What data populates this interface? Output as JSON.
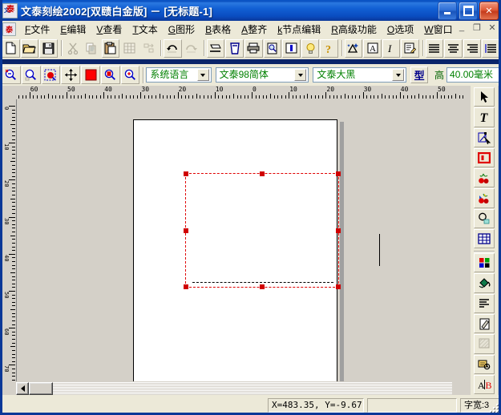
{
  "window": {
    "title": "文泰刻绘2002[双赜白金版]  －  [无标题-1]",
    "app_icon": "app-icon",
    "minimize": "_",
    "maximize": "□",
    "close": "✕"
  },
  "menubar": {
    "items": [
      {
        "accel": "F",
        "label": "文件",
        "name": "menu-file"
      },
      {
        "accel": "E",
        "label": "编辑",
        "name": "menu-edit"
      },
      {
        "accel": "V",
        "label": "查看",
        "name": "menu-view"
      },
      {
        "accel": "T",
        "label": "文本",
        "name": "menu-text"
      },
      {
        "accel": "G",
        "label": "图形",
        "name": "menu-graphics"
      },
      {
        "accel": "B",
        "label": "表格",
        "name": "menu-table"
      },
      {
        "accel": "A",
        "label": "整齐",
        "name": "menu-align"
      },
      {
        "accel": "k",
        "label": "节点编辑",
        "name": "menu-node-edit"
      },
      {
        "accel": "R",
        "label": "高级功能",
        "name": "menu-advanced"
      },
      {
        "accel": "O",
        "label": "选项",
        "name": "menu-options"
      },
      {
        "accel": "W",
        "label": "窗口",
        "name": "menu-window"
      }
    ],
    "mdi_minimize": "_",
    "mdi_restore": "❐",
    "mdi_close": "✕"
  },
  "toolbar_main": {
    "buttons": [
      {
        "name": "new-file-icon",
        "tip": "新建"
      },
      {
        "name": "open-file-icon",
        "tip": "打开"
      },
      {
        "name": "save-file-icon",
        "tip": "保存"
      },
      {
        "name": "cut-icon",
        "tip": "剪切"
      },
      {
        "name": "copy-icon",
        "tip": "复制"
      },
      {
        "name": "paste-icon",
        "tip": "粘贴"
      },
      {
        "name": "array-copy-icon",
        "tip": "阵列"
      },
      {
        "name": "transform-icon",
        "tip": "变换"
      },
      {
        "name": "undo-icon",
        "tip": "撤销"
      },
      {
        "name": "redo-icon",
        "tip": "重做"
      },
      {
        "name": "cut-plot-icon",
        "tip": "刻绘输出"
      },
      {
        "name": "engrave-icon",
        "tip": "雕刻"
      },
      {
        "name": "print-icon",
        "tip": "打印"
      },
      {
        "name": "print-preview-icon",
        "tip": "打印预览"
      },
      {
        "name": "layout-icon",
        "tip": "排版"
      },
      {
        "name": "hint-icon",
        "tip": "提示"
      },
      {
        "name": "help-icon",
        "tip": "帮助"
      },
      {
        "name": "effect-icon",
        "tip": "特效"
      },
      {
        "name": "text-box-icon",
        "tip": "文字框"
      },
      {
        "name": "italic-icon",
        "tip": "倾斜"
      },
      {
        "name": "edit-note-icon",
        "tip": "编辑文本"
      },
      {
        "name": "align-left-icon",
        "tip": "左对齐"
      },
      {
        "name": "align-center-icon",
        "tip": "居中"
      },
      {
        "name": "align-right-icon",
        "tip": "右对齐"
      },
      {
        "name": "align-justify-icon",
        "tip": "分散对齐"
      }
    ]
  },
  "toolbar_view": {
    "buttons": [
      {
        "name": "zoom-out-icon",
        "tip": "缩小"
      },
      {
        "name": "zoom-area-icon",
        "tip": "框选缩放"
      },
      {
        "name": "zoom-selection-icon",
        "tip": "选中对象满屏"
      },
      {
        "name": "pan-icon",
        "tip": "平移"
      },
      {
        "name": "color-swatch-icon",
        "tip": "颜色",
        "color": "#ff0000"
      },
      {
        "name": "zoom-page-icon",
        "tip": "整页显示"
      },
      {
        "name": "zoom-fit-icon",
        "tip": "满屏显示"
      }
    ],
    "language_combo": {
      "value": "系统语言",
      "name": "language-combo"
    },
    "font_combo": {
      "value": "文泰98简体",
      "name": "font-combo"
    },
    "style_combo": {
      "value": "文泰大黑",
      "name": "style-combo"
    },
    "type_button": {
      "label": "型",
      "name": "type-button"
    },
    "height_label": "高",
    "height_value": "40.00毫米"
  },
  "rulers": {
    "unit": "毫米",
    "horizontal_ticks": [
      "20",
      "10",
      "0",
      "10",
      "20"
    ],
    "vertical_ticks": [
      "0",
      "10",
      "20",
      "30",
      "40",
      "50",
      "60",
      "70"
    ]
  },
  "canvas": {
    "page_name": "document-page",
    "selection": {
      "name": "selection-rectangle",
      "handles": 8,
      "color": "#e00000"
    },
    "caret_name": "text-caret"
  },
  "right_toolbar": {
    "buttons": [
      {
        "name": "select-arrow-icon",
        "tip": "选择"
      },
      {
        "name": "text-tool-icon",
        "tip": "文字"
      },
      {
        "name": "node-edit-icon",
        "tip": "节点编辑"
      },
      {
        "name": "rectangle-tool-icon",
        "tip": "矩形"
      },
      {
        "name": "fruit-tool-icon",
        "tip": "图库"
      },
      {
        "name": "fruit-color-icon",
        "tip": "彩色图库"
      },
      {
        "name": "magnifier-tool-icon",
        "tip": "放大镜"
      },
      {
        "name": "table-tool-icon",
        "tip": "表格"
      },
      {
        "name": "palette-icon",
        "tip": "调色板"
      },
      {
        "name": "fill-bucket-icon",
        "tip": "填充"
      },
      {
        "name": "line-style-icon",
        "tip": "线型"
      },
      {
        "name": "pen-tool-icon",
        "tip": "钢笔"
      },
      {
        "name": "hatch-icon",
        "tip": "阴影"
      },
      {
        "name": "object-props-icon",
        "tip": "属性"
      },
      {
        "name": "ab-compare-icon",
        "tip": "A/B"
      }
    ]
  },
  "scrollbars": {
    "vertical_up": "▲",
    "vertical_down": "▼",
    "horizontal_left": "◀",
    "horizontal_right": "▶"
  },
  "statusbar": {
    "coordinates": "X=483.35, Y=-9.67",
    "message": "",
    "char_width": "字宽:3"
  }
}
